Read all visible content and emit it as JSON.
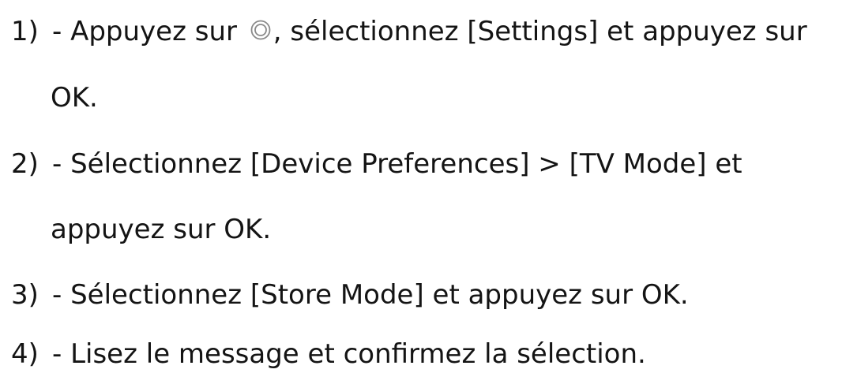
{
  "steps": [
    {
      "number": "1)",
      "line1_before_icon": "- Appuyez sur ",
      "icon": "home-circle-icon",
      "line1_after_icon": ", sélectionnez [Settings] et appuyez sur",
      "line2": "OK."
    },
    {
      "number": "2)",
      "line1": "- Sélectionnez [Device Preferences] > [TV Mode] et",
      "line2": "appuyez sur OK."
    },
    {
      "number": "3)",
      "line1": "- Sélectionnez [Store Mode] et appuyez sur OK."
    },
    {
      "number": "4)",
      "line1": "- Lisez le message et confirmez la sélection."
    }
  ]
}
